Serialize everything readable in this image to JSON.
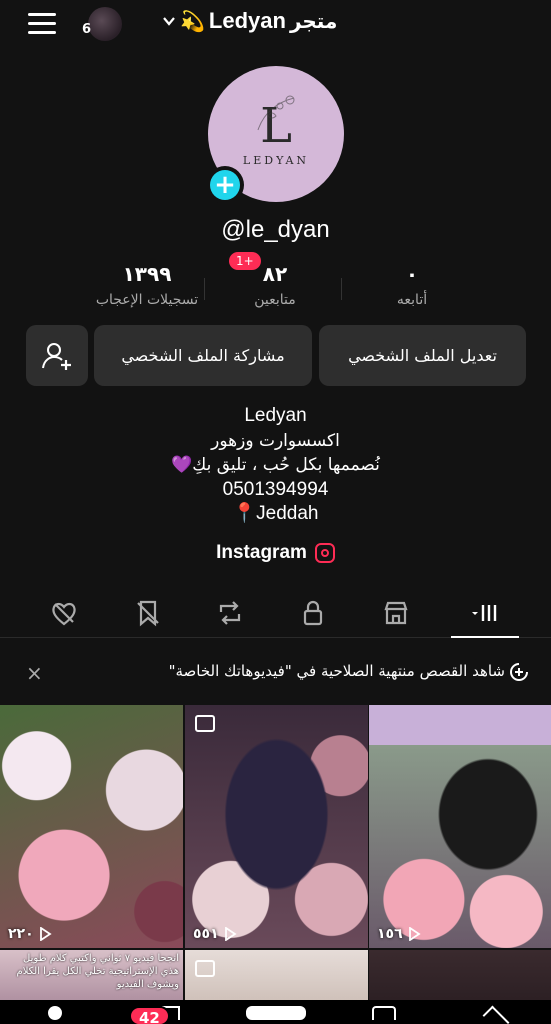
{
  "header": {
    "story_count": "6",
    "store_name": "Ledyan",
    "store_suffix": "متجر",
    "emoji": "💫"
  },
  "profile": {
    "username": "@le_dyan",
    "avatar_letter": "L",
    "avatar_brand": "LEDYAN"
  },
  "stats": {
    "likes_value": "١٣٩٩",
    "likes_label": "تسجيلات الإعجاب",
    "followers_value": "٨٢",
    "followers_label": "متابعين",
    "followers_new": "1+",
    "following_value": "٠",
    "following_label": "أتابعه"
  },
  "buttons": {
    "edit": "تعديل الملف الشخصي",
    "share": "مشاركة الملف الشخصي"
  },
  "bio": {
    "name": "Ledyan",
    "line1": "اكسسوارت وزهور",
    "line2": "نُصممها بكل حُب ، تليق بكِ",
    "line2_emoji": "💜",
    "phone": "0501394994",
    "location_emoji": "📍",
    "location": "Jeddah"
  },
  "instagram_label": "Instagram",
  "banner": {
    "text": "شاهد القصص منتهية الصلاحية في \"فيديوهاتك الخاصة\"",
    "close": "×"
  },
  "grid": {
    "items": [
      {
        "views": "٢٢٠"
      },
      {
        "views": "٥٥١"
      },
      {
        "views": "١٥٦"
      }
    ],
    "caption": "انجحا فيديو ٧ ثواني واكتبي كلام طويل هذي الإستراتيجية تخلي الكل يقرا الكلام ويشوف الفيديو"
  },
  "nav": {
    "inbox_badge": "42"
  },
  "colors": {
    "accent": "#fe2c55",
    "plus": "#20d5ec",
    "avatar_bg": "#d4b8d8"
  }
}
